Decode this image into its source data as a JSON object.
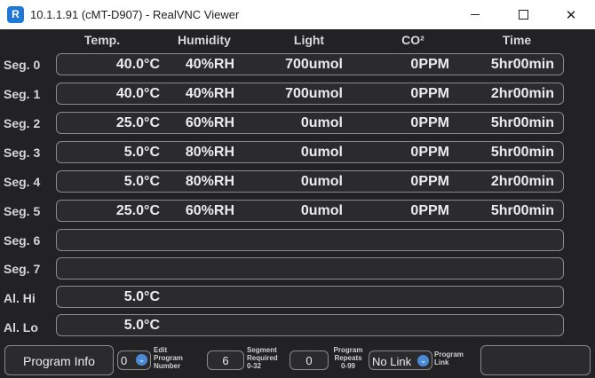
{
  "window": {
    "title": "10.1.1.91 (cMT-D907) - RealVNC Viewer",
    "app_icon": "R"
  },
  "headers": [
    "Temp.",
    "Humidity",
    "Light",
    "CO²",
    "Time"
  ],
  "segments": [
    {
      "label": "Seg. 0",
      "temp": "40.0°C",
      "humidity": "40%RH",
      "light": "700umol",
      "co2": "0PPM",
      "time": "5hr00min"
    },
    {
      "label": "Seg. 1",
      "temp": "40.0°C",
      "humidity": "40%RH",
      "light": "700umol",
      "co2": "0PPM",
      "time": "2hr00min"
    },
    {
      "label": "Seg. 2",
      "temp": "25.0°C",
      "humidity": "60%RH",
      "light": "0umol",
      "co2": "0PPM",
      "time": "5hr00min"
    },
    {
      "label": "Seg. 3",
      "temp": "5.0°C",
      "humidity": "80%RH",
      "light": "0umol",
      "co2": "0PPM",
      "time": "5hr00min"
    },
    {
      "label": "Seg. 4",
      "temp": "5.0°C",
      "humidity": "80%RH",
      "light": "0umol",
      "co2": "0PPM",
      "time": "2hr00min"
    },
    {
      "label": "Seg. 5",
      "temp": "25.0°C",
      "humidity": "60%RH",
      "light": "0umol",
      "co2": "0PPM",
      "time": "5hr00min"
    },
    {
      "label": "Seg. 6",
      "temp": "",
      "humidity": "",
      "light": "",
      "co2": "",
      "time": ""
    },
    {
      "label": "Seg. 7",
      "temp": "",
      "humidity": "",
      "light": "",
      "co2": "",
      "time": ""
    }
  ],
  "alarms": [
    {
      "label": "Al. Hi",
      "temp": "5.0°C"
    },
    {
      "label": "Al. Lo",
      "temp": "5.0°C"
    }
  ],
  "bottom": {
    "program_info_label": "Program Info",
    "edit_program_value": "0",
    "edit_program_label": "Edit Program Number",
    "segment_required_value": "6",
    "segment_required_label": "Segment Required 0-32",
    "program_repeats_value": "0",
    "program_repeats_label": "Program Repeats 0-99",
    "program_link_value": "No Link",
    "program_link_label": "Program Link",
    "empty_button_label": ""
  }
}
